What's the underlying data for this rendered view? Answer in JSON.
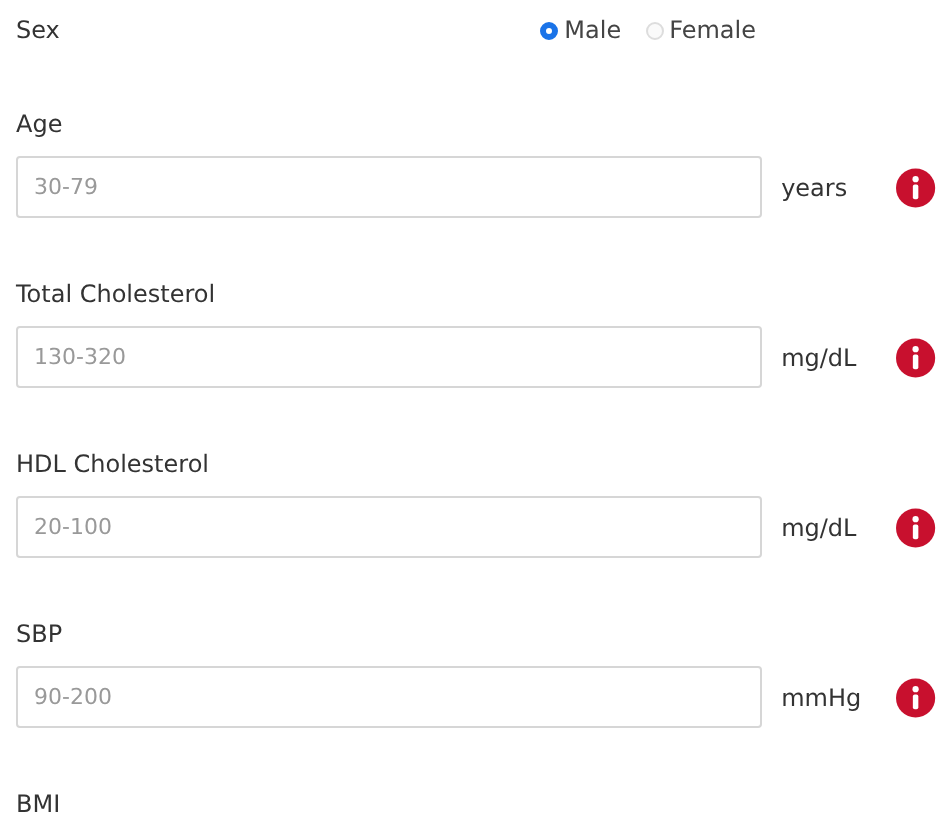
{
  "sex": {
    "label": "Sex",
    "options": [
      {
        "label": "Male",
        "selected": true
      },
      {
        "label": "Female",
        "selected": false
      }
    ]
  },
  "fields": [
    {
      "label": "Age",
      "placeholder": "30-79",
      "unit": "years"
    },
    {
      "label": "Total Cholesterol",
      "placeholder": "130-320",
      "unit": "mg/dL"
    },
    {
      "label": "HDL Cholesterol",
      "placeholder": "20-100",
      "unit": "mg/dL"
    },
    {
      "label": "SBP",
      "placeholder": "90-200",
      "unit": "mmHg"
    },
    {
      "label": "BMI"
    }
  ]
}
